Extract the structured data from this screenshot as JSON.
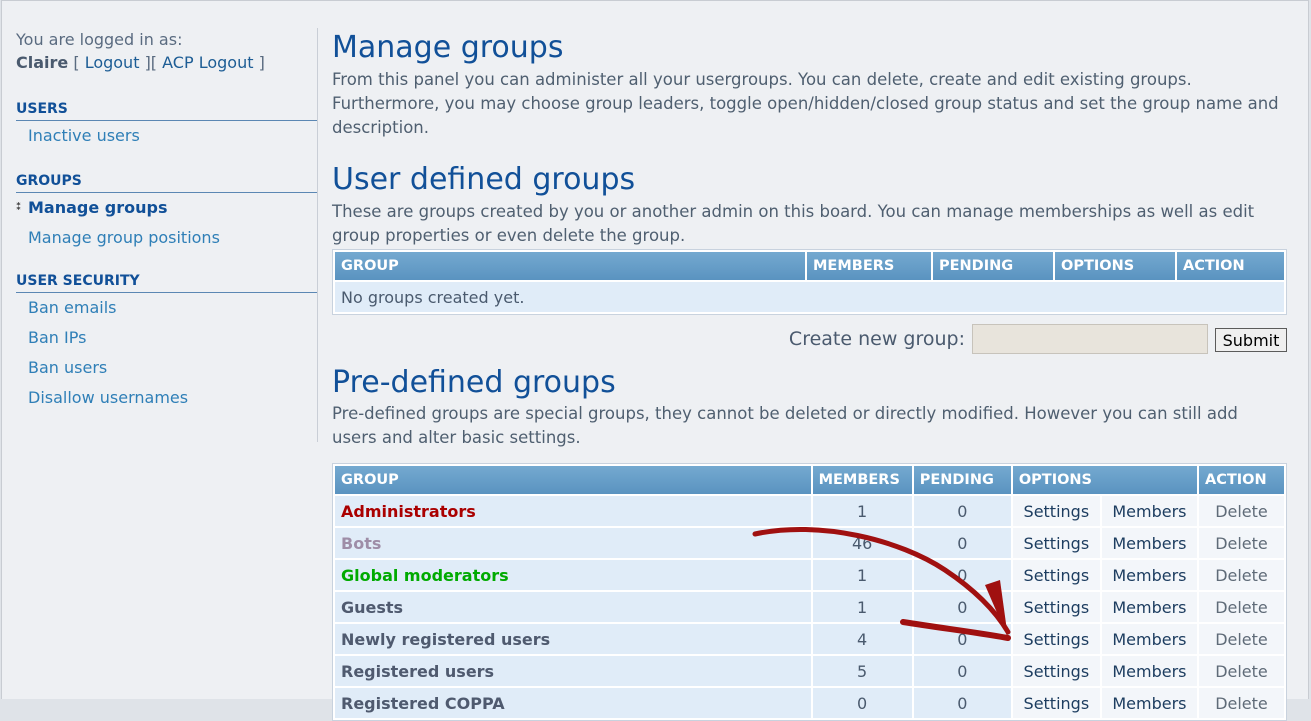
{
  "login": {
    "prefix": "You are logged in as:",
    "username": "Claire",
    "open1": "[",
    "logout": "Logout",
    "mid": "][",
    "acp_logout": "ACP Logout",
    "close": "]"
  },
  "sidebar": {
    "users_heading": "USERS",
    "users_items": [
      "Inactive users"
    ],
    "groups_heading": "GROUPS",
    "groups_items": [
      "Manage groups",
      "Manage group positions"
    ],
    "security_heading": "USER SECURITY",
    "security_items": [
      "Ban emails",
      "Ban IPs",
      "Ban users",
      "Disallow usernames"
    ]
  },
  "main": {
    "title": "Manage groups",
    "intro": "From this panel you can administer all your usergroups. You can delete, create and edit existing groups. Furthermore, you may choose group leaders, toggle open/hidden/closed group status and set the group name and description.",
    "user_defined": {
      "title": "User defined groups",
      "desc": "These are groups created by you or another admin on this board. You can manage memberships as well as edit group properties or even delete the group.",
      "headers": [
        "Group",
        "Members",
        "Pending",
        "Options",
        "Action"
      ],
      "empty": "No groups created yet."
    },
    "create": {
      "label": "Create new group:",
      "value": "",
      "submit": "Submit"
    },
    "predefined": {
      "title": "Pre-defined groups",
      "desc": "Pre-defined groups are special groups, they cannot be deleted or directly modified. However you can still add users and alter basic settings.",
      "headers": [
        "Group",
        "Members",
        "Pending",
        "Options",
        "Action"
      ],
      "rows": [
        {
          "name": "Administrators",
          "members": "1",
          "pending": "0",
          "settings": "Settings",
          "members_link": "Members",
          "action": "Delete"
        },
        {
          "name": "Bots",
          "members": "46",
          "pending": "0",
          "settings": "Settings",
          "members_link": "Members",
          "action": "Delete"
        },
        {
          "name": "Global moderators",
          "members": "1",
          "pending": "0",
          "settings": "Settings",
          "members_link": "Members",
          "action": "Delete"
        },
        {
          "name": "Guests",
          "members": "1",
          "pending": "0",
          "settings": "Settings",
          "members_link": "Members",
          "action": "Delete"
        },
        {
          "name": "Newly registered users",
          "members": "4",
          "pending": "0",
          "settings": "Settings",
          "members_link": "Members",
          "action": "Delete"
        },
        {
          "name": "Registered users",
          "members": "5",
          "pending": "0",
          "settings": "Settings",
          "members_link": "Members",
          "action": "Delete"
        },
        {
          "name": "Registered COPPA",
          "members": "0",
          "pending": "0",
          "settings": "Settings",
          "members_link": "Members",
          "action": "Delete"
        }
      ]
    }
  },
  "colors": {
    "heading": "#115098",
    "link": "#2f7fb7",
    "table_header": "#5a93c0",
    "admin_group": "#aa0000",
    "gmod_group": "#00aa00",
    "bots_group": "#9e8da7",
    "annotation_arrow": "#a01010"
  },
  "icons": {
    "active_marker": "arrow-marker-icon",
    "annotation": "annotation-arrow-icon"
  }
}
